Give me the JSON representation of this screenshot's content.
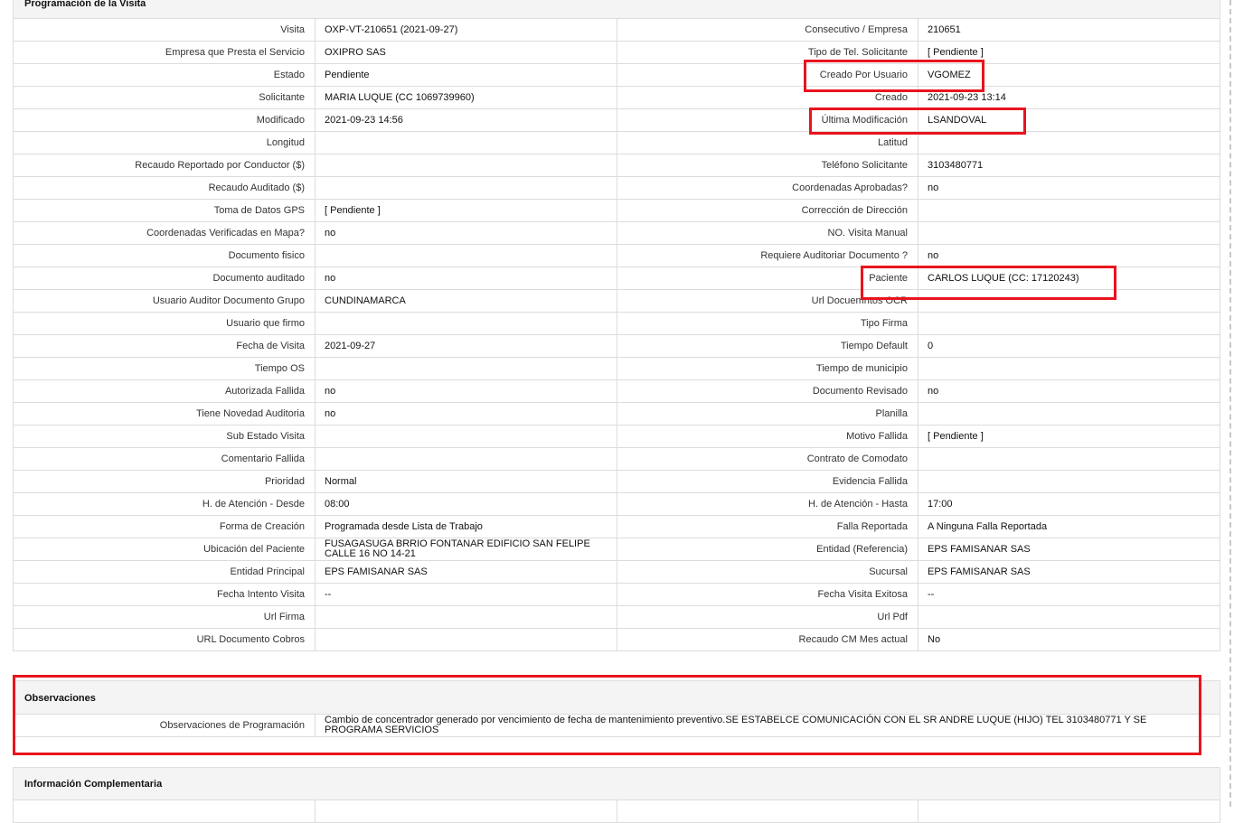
{
  "sections": {
    "programacion_title": "Programación de la Visita",
    "observaciones_title": "Observaciones",
    "info_title": "Información Complementaria"
  },
  "rows": [
    {
      "l1": "Visita",
      "v1": "OXP-VT-210651 (2021-09-27)",
      "l2": "Consecutivo / Empresa",
      "v2": "210651"
    },
    {
      "l1": "Empresa que Presta el Servicio",
      "v1": "OXIPRO SAS",
      "l2": "Tipo de Tel. Solicitante",
      "v2": "[ Pendiente ]"
    },
    {
      "l1": "Estado",
      "v1": "Pendiente",
      "l2": "Creado Por Usuario",
      "v2": "VGOMEZ"
    },
    {
      "l1": "Solicitante",
      "v1": "MARIA LUQUE (CC 1069739960)",
      "l2": "Creado",
      "v2": "2021-09-23 13:14"
    },
    {
      "l1": "Modificado",
      "v1": "2021-09-23 14:56",
      "l2": "Última Modificación",
      "v2": "LSANDOVAL"
    },
    {
      "l1": "Longitud",
      "v1": "",
      "l2": "Latitud",
      "v2": ""
    },
    {
      "l1": "Recaudo Reportado por Conductor ($)",
      "v1": "",
      "l2": "Teléfono Solicitante",
      "v2": "3103480771"
    },
    {
      "l1": "Recaudo Auditado ($)",
      "v1": "",
      "l2": "Coordenadas Aprobadas?",
      "v2": "no"
    },
    {
      "l1": "Toma de Datos GPS",
      "v1": "[ Pendiente ]",
      "l2": "Corrección de Dirección",
      "v2": ""
    },
    {
      "l1": "Coordenadas Verificadas en Mapa?",
      "v1": "no",
      "l2": "NO. Visita Manual",
      "v2": ""
    },
    {
      "l1": "Documento fisico",
      "v1": "",
      "l2": "Requiere Auditoriar Documento ?",
      "v2": "no"
    },
    {
      "l1": "Documento auditado",
      "v1": "no",
      "l2": "Paciente",
      "v2": "CARLOS LUQUE (CC: 17120243)"
    },
    {
      "l1": "Usuario Auditor Documento Grupo",
      "v1": "CUNDINAMARCA",
      "l2": "Url Docuemntos OCR",
      "v2": ""
    },
    {
      "l1": "Usuario que firmo",
      "v1": "",
      "l2": "Tipo Firma",
      "v2": ""
    },
    {
      "l1": "Fecha de Visita",
      "v1": "2021-09-27",
      "l2": "Tiempo Default",
      "v2": "0"
    },
    {
      "l1": "Tiempo OS",
      "v1": "",
      "l2": "Tiempo de municipio",
      "v2": ""
    },
    {
      "l1": "Autorizada Fallida",
      "v1": "no",
      "l2": "Documento Revisado",
      "v2": "no"
    },
    {
      "l1": "Tiene Novedad Auditoria",
      "v1": "no",
      "l2": "Planilla",
      "v2": ""
    },
    {
      "l1": "Sub Estado Visita",
      "v1": "",
      "l2": "Motivo Fallida",
      "v2": "[ Pendiente ]"
    },
    {
      "l1": "Comentario Fallida",
      "v1": "",
      "l2": "Contrato de Comodato",
      "v2": ""
    },
    {
      "l1": "Prioridad",
      "v1": "Normal",
      "l2": "Evidencia Fallida",
      "v2": ""
    },
    {
      "l1": "H. de Atención - Desde",
      "v1": "08:00",
      "l2": "H. de Atención - Hasta",
      "v2": "17:00"
    },
    {
      "l1": "Forma de Creación",
      "v1": "Programada desde Lista de Trabajo",
      "l2": "Falla Reportada",
      "v2": "A Ninguna Falla Reportada"
    },
    {
      "l1": "Ubicación del Paciente",
      "v1": "FUSAGASUGA BRRIO FONTANAR EDIFICIO SAN FELIPE CALLE 16 NO 14-21",
      "l2": "Entidad (Referencia)",
      "v2": "EPS FAMISANAR SAS"
    },
    {
      "l1": "Entidad Principal",
      "v1": "EPS FAMISANAR SAS",
      "l2": "Sucursal",
      "v2": "EPS FAMISANAR SAS"
    },
    {
      "l1": "Fecha Intento Visita",
      "v1": "--",
      "l2": "Fecha Visita Exitosa",
      "v2": "--"
    },
    {
      "l1": "Url Firma",
      "v1": "",
      "l2": "Url Pdf",
      "v2": ""
    },
    {
      "l1": "URL Documento Cobros",
      "v1": "",
      "l2": "Recaudo CM Mes actual",
      "v2": "No"
    }
  ],
  "observaciones": {
    "label": "Observaciones de Programación",
    "value": "Cambio de concentrador generado por vencimiento de fecha de mantenimiento preventivo.SE ESTABELCE COMUNICACIÓN CON EL SR ANDRE LUQUE (HIJO) TEL 3103480771 Y SE PROGRAMA SERVICIOS"
  },
  "highlight_color": "#e8141e"
}
